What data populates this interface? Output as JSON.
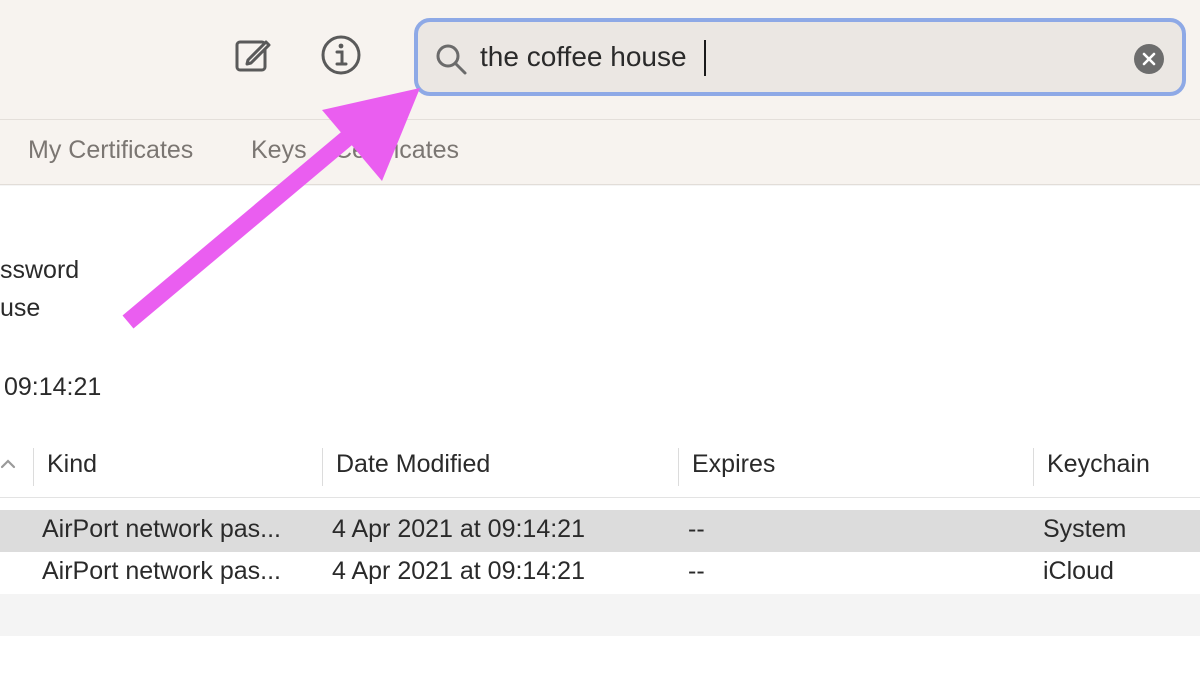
{
  "toolbar": {
    "icons": [
      "compose-icon",
      "info-icon"
    ],
    "search": {
      "value": "the coffee house",
      "icon": "search-icon",
      "clear_icon": "clear-icon"
    }
  },
  "tabs": [
    {
      "label": "My Certificates"
    },
    {
      "label": "Keys"
    },
    {
      "label": "Certificates"
    }
  ],
  "detail": {
    "line1": "ssword",
    "line2": "use",
    "line3": "09:14:21"
  },
  "table": {
    "columns": [
      "Kind",
      "Date Modified",
      "Expires",
      "Keychain"
    ],
    "rows": [
      {
        "kind": "AirPort network pas...",
        "date_modified": "4 Apr 2021 at 09:14:21",
        "expires": "--",
        "keychain": "System"
      },
      {
        "kind": "AirPort network pas...",
        "date_modified": "4 Apr 2021 at 09:14:21",
        "expires": "--",
        "keychain": "iCloud"
      }
    ]
  },
  "colors": {
    "search_focus_ring": "#8ea9e6",
    "annotation_arrow": "#ea5ef0",
    "selected_row": "#dcdcdc"
  }
}
